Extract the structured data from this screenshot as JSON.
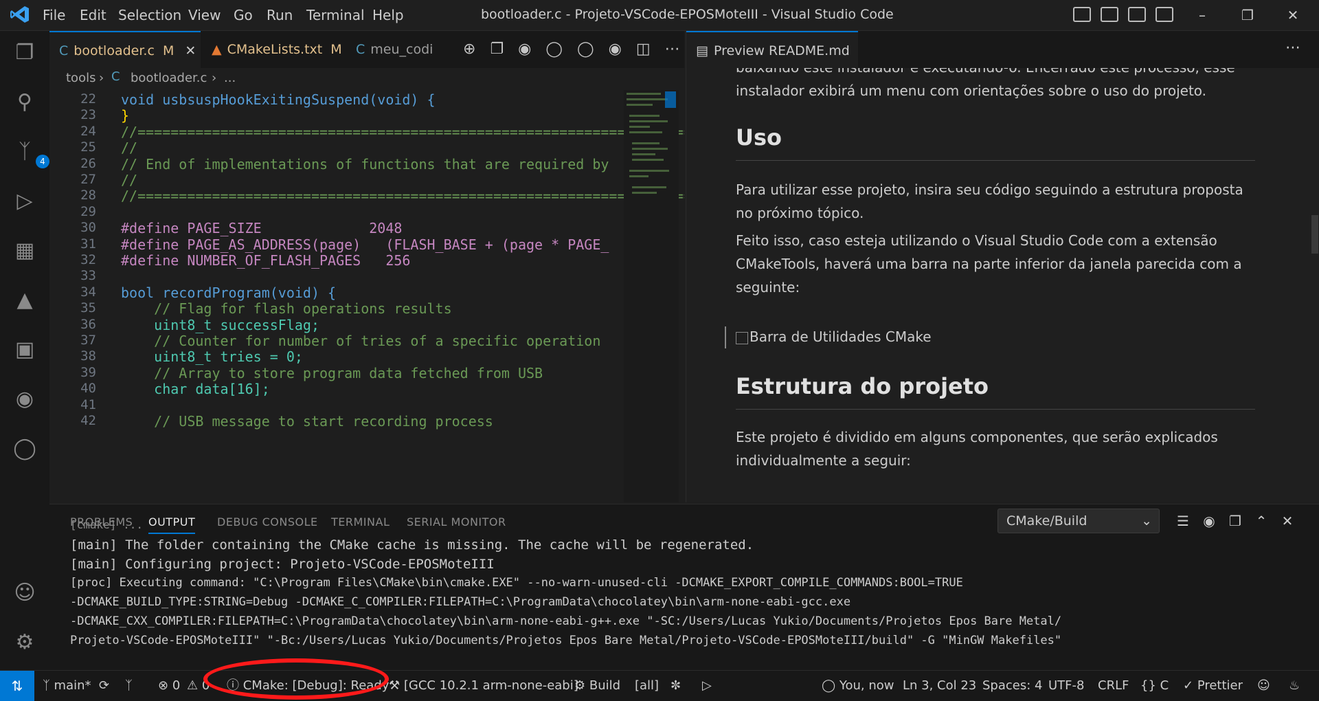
{
  "titlebar": {
    "menu": [
      "File",
      "Edit",
      "Selection",
      "View",
      "Go",
      "Run",
      "Terminal",
      "Help"
    ],
    "title": "bootloader.c - Projeto-VSCode-EPOSMoteIII - Visual Studio Code"
  },
  "activity_bar": {
    "items": [
      "explorer-icon",
      "search-icon",
      "source-control-icon",
      "run-debug-icon",
      "extensions-icon",
      "cmake-icon",
      "remote-explorer-icon",
      "testing-icon",
      "git-graph-icon"
    ],
    "source_control_badge": "4",
    "bottom": [
      "account-icon",
      "manage-icon"
    ]
  },
  "editor": {
    "tabs": [
      {
        "label": "bootloader.c",
        "badge": "M",
        "icon": "C",
        "active": true
      },
      {
        "label": "CMakeLists.txt",
        "badge": "M",
        "icon": "cmake-icon"
      },
      {
        "label": "meu_codi",
        "badge": "",
        "icon": "C"
      }
    ],
    "breadcrumb": [
      "tools",
      "bootloader.c",
      "..."
    ],
    "code": [
      {
        "n": "22",
        "text": "void usbsuspHookExitingSuspend(void) {"
      },
      {
        "n": "23",
        "text": "}"
      },
      {
        "n": "24",
        "text": "//==========================================================================="
      },
      {
        "n": "25",
        "text": "//"
      },
      {
        "n": "26",
        "text": "// End of implementations of functions that are required by"
      },
      {
        "n": "27",
        "text": "//"
      },
      {
        "n": "28",
        "text": "//==========================================================================="
      },
      {
        "n": "29",
        "text": ""
      },
      {
        "n": "30",
        "text": "#define PAGE_SIZE             2048"
      },
      {
        "n": "31",
        "text": "#define PAGE_AS_ADDRESS(page)   (FLASH_BASE + (page * PAGE_"
      },
      {
        "n": "32",
        "text": "#define NUMBER_OF_FLASH_PAGES   256"
      },
      {
        "n": "33",
        "text": ""
      },
      {
        "n": "34",
        "text": "bool recordProgram(void) {"
      },
      {
        "n": "35",
        "text": "    // Flag for flash operations results"
      },
      {
        "n": "36",
        "text": "    uint8_t successFlag;"
      },
      {
        "n": "37",
        "text": "    // Counter for number of tries of a specific operation"
      },
      {
        "n": "38",
        "text": "    uint8_t tries = 0;"
      },
      {
        "n": "39",
        "text": "    // Array to store program data fetched from USB"
      },
      {
        "n": "40",
        "text": "    char data[16];"
      },
      {
        "n": "41",
        "text": ""
      },
      {
        "n": "42",
        "text": "    // USB message to start recording process"
      }
    ]
  },
  "preview": {
    "tab_label": "Preview README.md",
    "intro": "baixando este instalador e executando-o. Encerrado este processo, esse instalador exibirá um menu com orientações sobre o uso do projeto.",
    "h_uso": "Uso",
    "p1": "Para utilizar esse projeto, insira seu código seguindo a estrutura proposta no próximo tópico.",
    "p2": "Feito isso, caso esteja utilizando o Visual Studio Code com a extensão CMakeTools, haverá uma barra na parte inferior da janela parecida com a seguinte:",
    "image_alt": "Barra de Utilidades CMake",
    "h_estrutura": "Estrutura do projeto",
    "p3": "Este projeto é dividido em alguns componentes, que serão explicados individualmente a seguir:"
  },
  "panel": {
    "tabs": [
      "PROBLEMS",
      "OUTPUT",
      "DEBUG CONSOLE",
      "TERMINAL",
      "SERIAL MONITOR"
    ],
    "active_tab": "OUTPUT",
    "output_channel": "CMake/Build",
    "lines": [
      "[main] The folder containing the CMake cache is missing. The cache will be regenerated.",
      "[main] Configuring project: Projeto-VSCode-EPOSMoteIII",
      "[proc] Executing command: \"C:\\Program Files\\CMake\\bin\\cmake.EXE\" --no-warn-unused-cli -DCMAKE_EXPORT_COMPILE_COMMANDS:BOOL=TRUE",
      "-DCMAKE_BUILD_TYPE:STRING=Debug -DCMAKE_C_COMPILER:FILEPATH=C:\\ProgramData\\chocolatey\\bin\\arm-none-eabi-gcc.exe",
      "-DCMAKE_CXX_COMPILER:FILEPATH=C:\\ProgramData\\chocolatey\\bin\\arm-none-eabi-g++.exe \"-SC:/Users/Lucas Yukio/Documents/Projetos Epos Bare Metal/",
      "Projeto-VSCode-EPOSMoteIII\" \"-Bc:/Users/Lucas Yukio/Documents/Projetos Epos Bare Metal/Projeto-VSCode-EPOSMoteIII/build\" -G \"MinGW Makefiles\""
    ]
  },
  "statusbar": {
    "branch": "main*",
    "errors": "0",
    "warnings": "0",
    "cmake_status": "CMake: [Debug]: Ready",
    "kit": "[GCC 10.2.1 arm-none-eabi]",
    "build": "Build",
    "target": "[all]",
    "blame": "You, now",
    "position": "Ln 3, Col 23",
    "spaces": "Spaces: 4",
    "encoding": "UTF-8",
    "eol": "CRLF",
    "language": "C",
    "formatter": "Prettier"
  },
  "colors": {
    "accent": "#0078d4",
    "highlight_circle": "#ff1a1a"
  }
}
